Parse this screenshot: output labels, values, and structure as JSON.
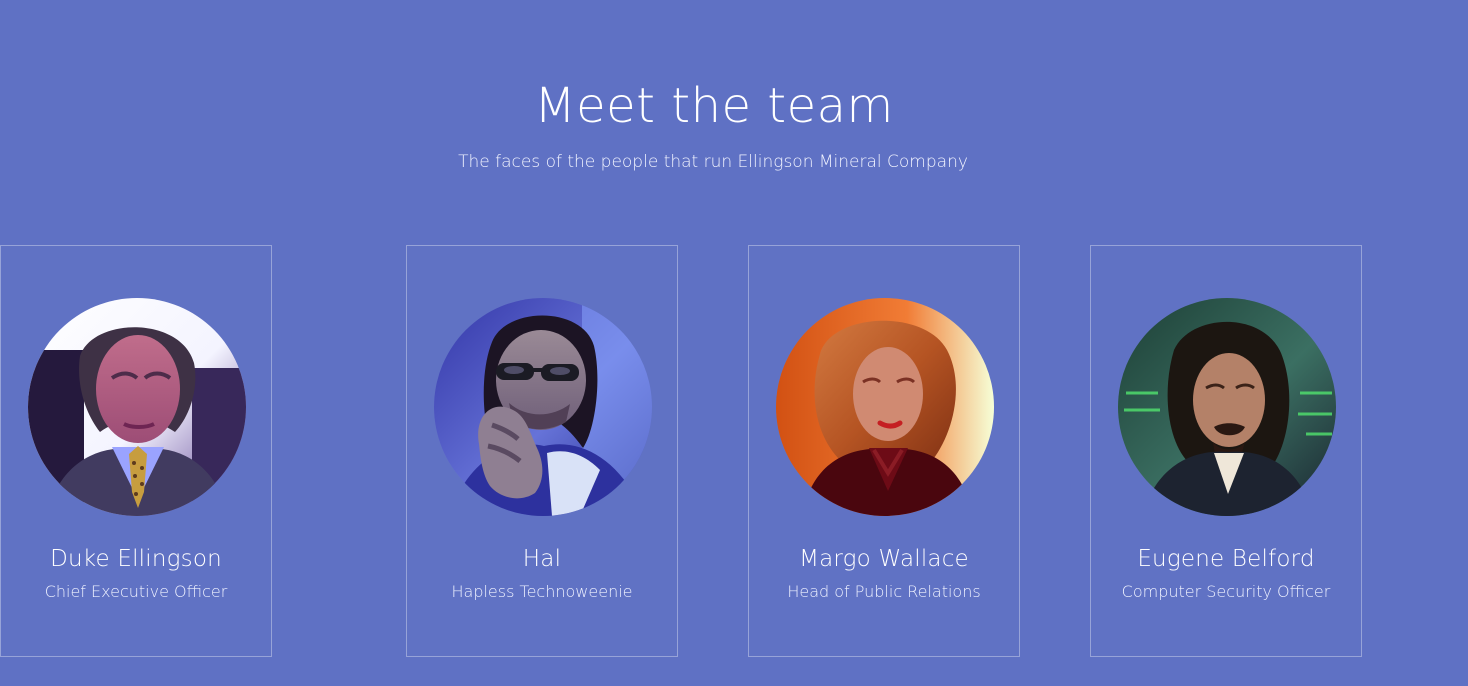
{
  "section": {
    "title": "Meet the team",
    "subtitle": "The faces of the people that run Ellingson Mineral Company"
  },
  "team": [
    {
      "name": "Hal",
      "role": "Hapless Technoweenie",
      "avatar_icon": "person-photo-icon"
    },
    {
      "name": "Margo Wallace",
      "role": "Head of Public Relations",
      "avatar_icon": "person-photo-icon"
    },
    {
      "name": "Eugene Belford",
      "role": "Computer Security Officer",
      "avatar_icon": "person-photo-icon"
    },
    {
      "name": "Duke Ellingson",
      "role": "Chief Executive Officer",
      "avatar_icon": "person-photo-icon"
    }
  ],
  "colors": {
    "background": "#5f71c4",
    "text": "#ffffff",
    "card_border": "#a8b3e6"
  }
}
